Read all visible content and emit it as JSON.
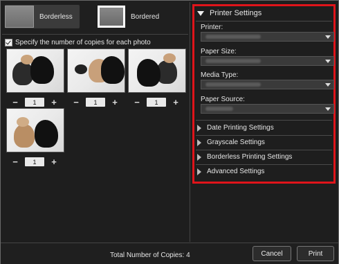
{
  "layout": {
    "borderless_label": "Borderless",
    "bordered_label": "Bordered"
  },
  "copies": {
    "checkbox_label": "Specify the number of copies for each photo",
    "photos": [
      {
        "qty": "1"
      },
      {
        "qty": "1"
      },
      {
        "qty": "1"
      },
      {
        "qty": "1"
      }
    ],
    "minus": "−",
    "plus": "+"
  },
  "printer_settings": {
    "title": "Printer Settings",
    "printer_label": "Printer:",
    "paper_size_label": "Paper Size:",
    "media_type_label": "Media Type:",
    "paper_source_label": "Paper Source:"
  },
  "collapsed_sections": [
    "Date Printing Settings",
    "Grayscale Settings",
    "Borderless Printing Settings",
    "Advanced Settings"
  ],
  "footer": {
    "total_label": "Total Number of Copies:",
    "total_value": "4",
    "cancel": "Cancel",
    "print": "Print"
  },
  "colors": {
    "highlight": "#e0141a"
  }
}
